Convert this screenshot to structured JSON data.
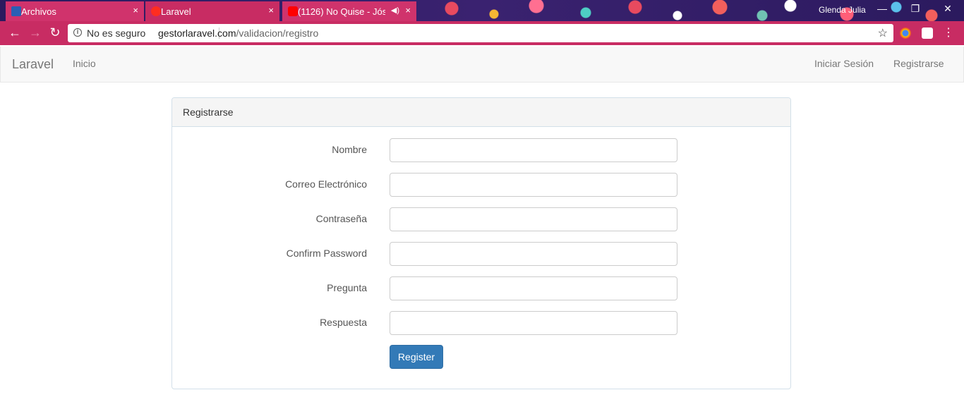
{
  "browser": {
    "tabs": [
      {
        "title": "Archivos",
        "close": "×"
      },
      {
        "title": "Laravel",
        "close": "×"
      },
      {
        "title": "(1126) No Quise - Jós",
        "close": "×"
      }
    ],
    "profile_name": "Glenda Julia",
    "window_controls": {
      "minimize": "—",
      "restore": "❐",
      "close": "✕"
    },
    "security_label": "No es seguro",
    "url_host": "gestorlaravel.com",
    "url_path": "/validacion/registro",
    "colors": {
      "tab_accent": "#c82c63",
      "primary": "#337ab7"
    }
  },
  "navbar": {
    "brand": "Laravel",
    "links": [
      "Inicio"
    ],
    "right_links": [
      "Iniciar Sesión",
      "Registrarse"
    ]
  },
  "panel": {
    "heading": "Registrarse",
    "fields": [
      {
        "label": "Nombre",
        "value": ""
      },
      {
        "label": "Correo Electrónico",
        "value": ""
      },
      {
        "label": "Contraseña",
        "value": ""
      },
      {
        "label": "Confirm Password",
        "value": ""
      },
      {
        "label": "Pregunta",
        "value": ""
      },
      {
        "label": "Respuesta",
        "value": ""
      }
    ],
    "submit_label": "Register"
  }
}
